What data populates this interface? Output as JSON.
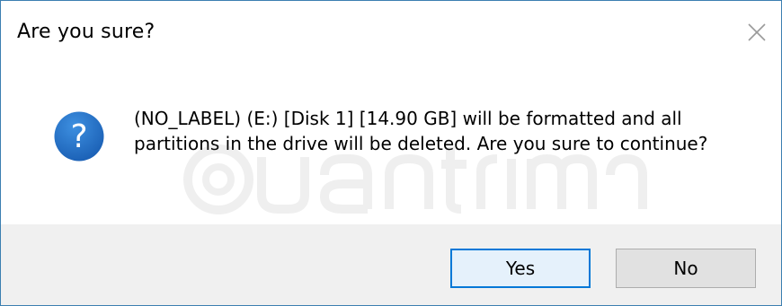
{
  "dialog": {
    "title": "Are you sure?",
    "message": "(NO_LABEL) (E:) [Disk 1] [14.90 GB] will be formatted and all partitions in the drive will be deleted. Are you sure to continue?",
    "icon": "question-icon",
    "close_icon": "close-icon"
  },
  "buttons": {
    "yes_label": "Yes",
    "no_label": "No"
  },
  "colors": {
    "border": "#3c7fb1",
    "icon_blue": "#1a5fb4",
    "button_area": "#f0f0f0",
    "default_button_border": "#0078d7",
    "default_button_bg": "#e5f1fb",
    "button_bg": "#e1e1e1"
  }
}
